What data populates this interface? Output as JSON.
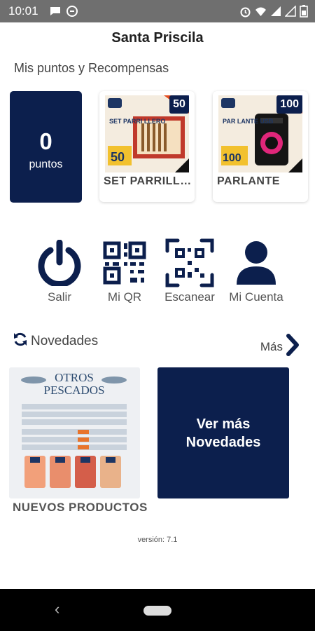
{
  "status_bar": {
    "time": "10:01"
  },
  "app": {
    "title": "Santa Priscila"
  },
  "rewards_section": {
    "title": "Mis puntos y Recompensas"
  },
  "points": {
    "value": "0",
    "label": "puntos"
  },
  "rewards": [
    {
      "name": "SET PARRILLE..",
      "points": "50",
      "image_text": "SET PARRI LLERO",
      "image_points": "50"
    },
    {
      "name": "PARLANTE",
      "points": "100",
      "image_text": "PAR LANTE USB",
      "image_points": "100"
    }
  ],
  "actions": [
    {
      "label": "Salir",
      "icon": "power-icon"
    },
    {
      "label": "Mi QR",
      "icon": "qr-icon"
    },
    {
      "label": "Escanear",
      "icon": "scan-icon"
    },
    {
      "label": "Mi Cuenta",
      "icon": "user-icon"
    }
  ],
  "news_section": {
    "title": "Novedades",
    "more_label": "Más"
  },
  "news": [
    {
      "title": "NUEVOS PRODUCTOS",
      "image_heading_1": "OTROS",
      "image_heading_2": "PESCADOS"
    }
  ],
  "see_more": {
    "line1": "Ver más",
    "line2": "Novedades"
  },
  "footer": {
    "version": "versión: 7.1"
  },
  "colors": {
    "brand_navy": "#0c1f4d",
    "status_bar": "#6f6f6f",
    "nav_bar": "#000000"
  }
}
